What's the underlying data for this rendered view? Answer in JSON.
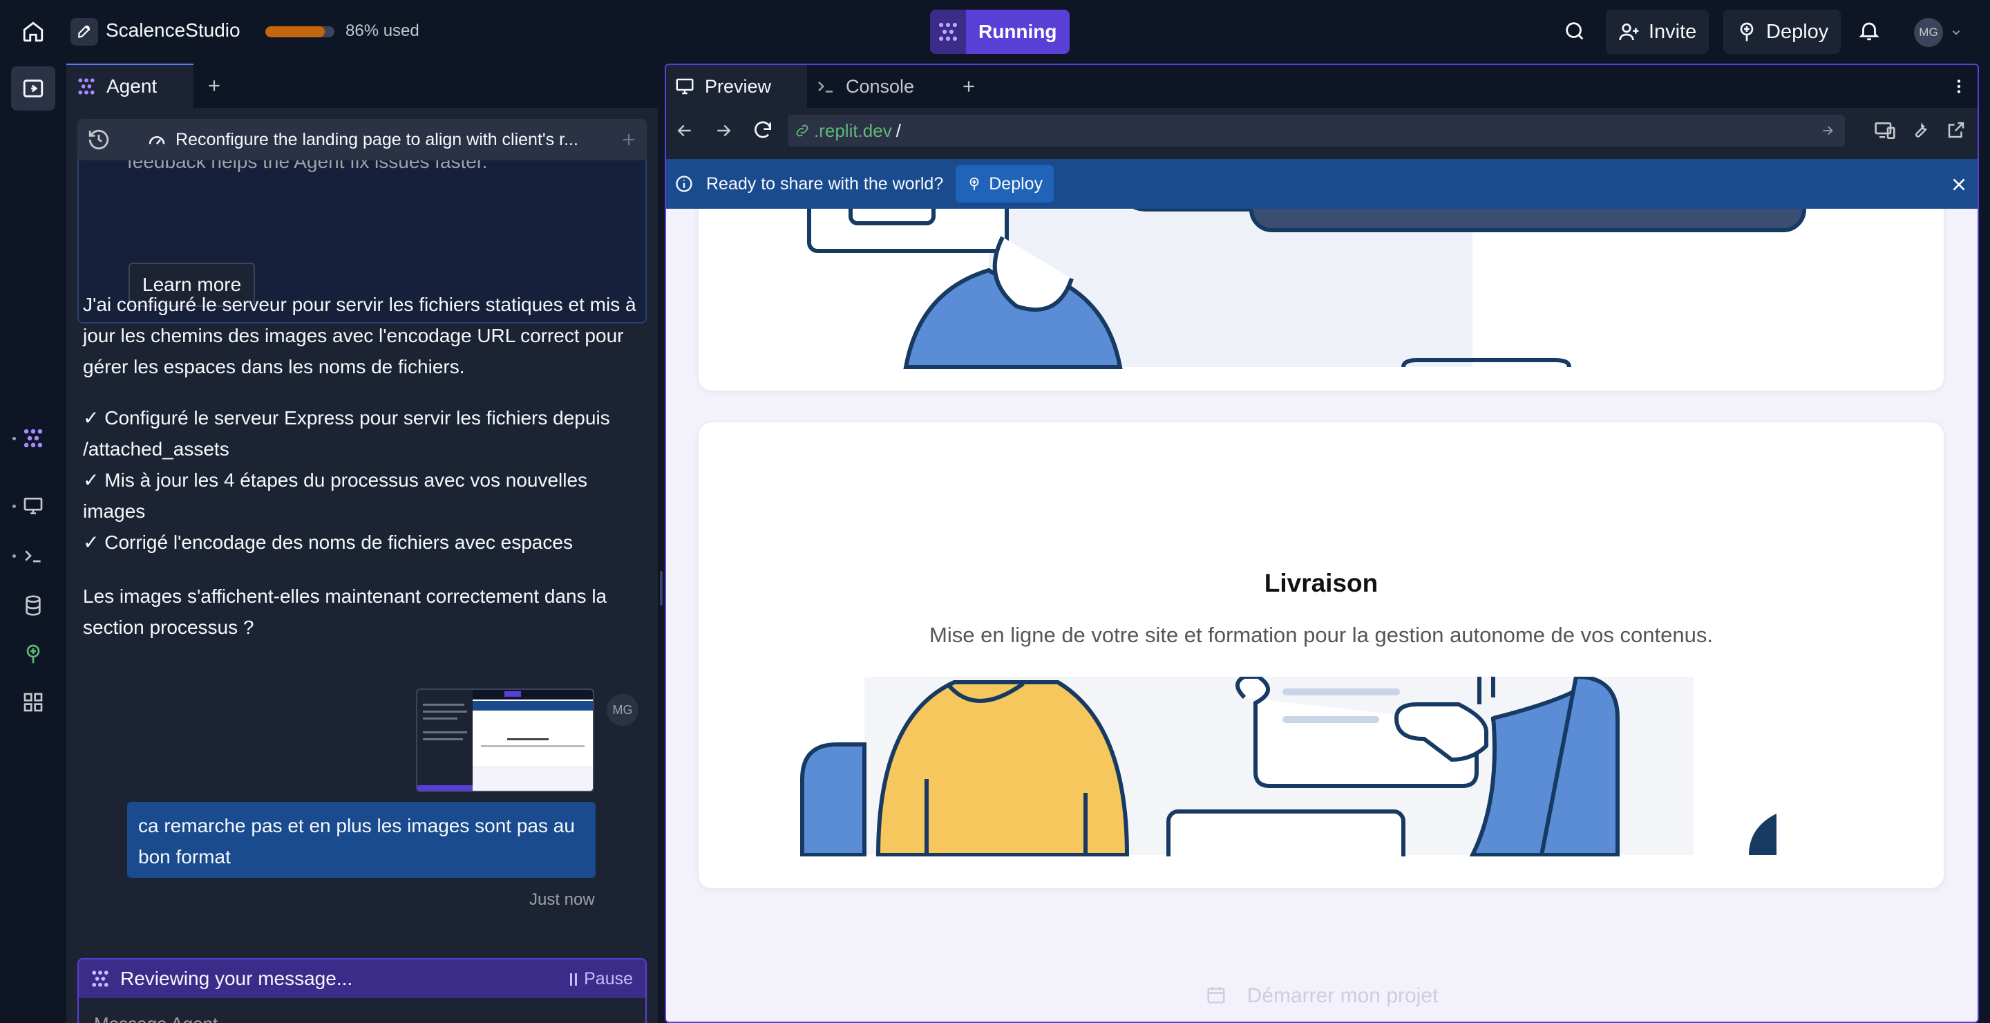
{
  "topbar": {
    "app_name": "ScalenceStudio",
    "usage_percent": 86,
    "usage_label": "86% used",
    "run_label": "Running",
    "invite_label": "Invite",
    "deploy_label": "Deploy",
    "avatar_initials": "MG"
  },
  "agent": {
    "tab_label": "Agent",
    "history_title": "Reconfigure the landing page to align with client's r...",
    "info_text": "feedback helps the Agent fix issues faster.",
    "learn_more": "Learn more",
    "msg1": "J'ai configuré le serveur pour servir les fichiers statiques et mis à jour les chemins des images avec l'encodage URL correct pour gérer les espaces dans les noms de fichiers.",
    "checks": [
      "✓ Configuré le serveur Express pour servir les fichiers depuis /attached_assets",
      "✓ Mis à jour les 4 étapes du processus avec vos nouvelles images",
      "✓ Corrigé l'encodage des noms de fichiers avec espaces"
    ],
    "question": "Les images s'affichent-elles maintenant correctement dans la section processus ?",
    "user_initials": "MG",
    "user_message": "ca remarche pas et en plus les images sont pas au bon format",
    "timestamp": "Just now",
    "reviewing": "Reviewing your message...",
    "pause": "Pause",
    "input_placeholder": "Message Agent..."
  },
  "preview": {
    "tabs": [
      {
        "label": "Preview",
        "active": true
      },
      {
        "label": "Console",
        "active": false
      }
    ],
    "url_domain": ".replit.dev",
    "url_path": "/",
    "banner_text": "Ready to share with the world?",
    "banner_deploy": "Deploy",
    "card2_title": "Livraison",
    "card2_desc": "Mise en ligne de votre site et formation pour la gestion autonome de vos contenus.",
    "cta": "Démarrer mon projet"
  },
  "colors": {
    "accent": "#5a3fd6",
    "banner": "#1a4b8f",
    "usage": "#c2660d"
  }
}
